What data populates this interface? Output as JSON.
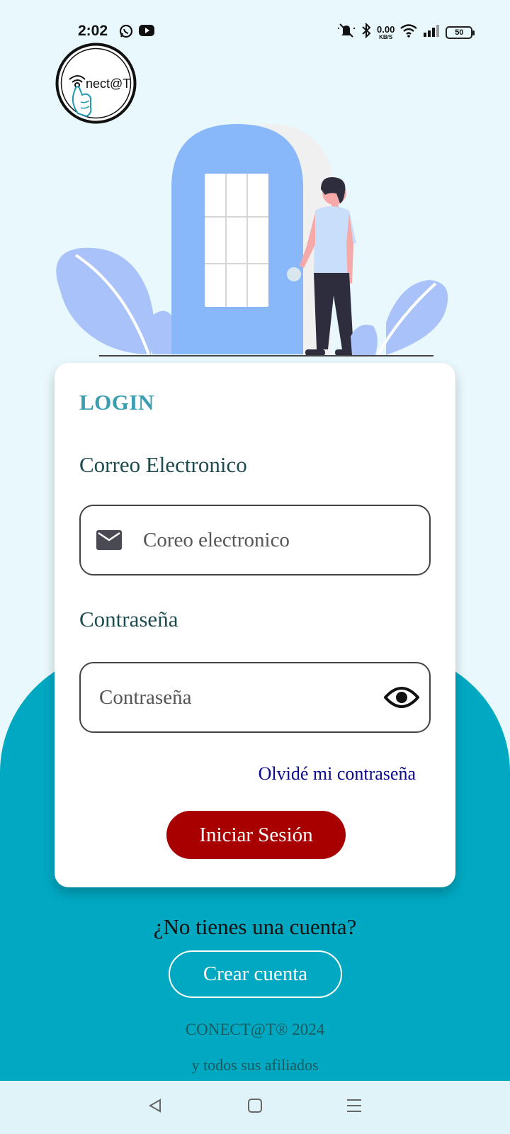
{
  "status_bar": {
    "time": "2:02",
    "net_speed_value": "0.00",
    "net_speed_unit": "KB/S",
    "battery": "50",
    "icons": [
      "whatsapp-icon",
      "youtube-icon",
      "mute-icon",
      "bluetooth-icon",
      "wifi-icon",
      "signal-icon",
      "battery-icon"
    ]
  },
  "logo": {
    "text": "nect@T"
  },
  "login": {
    "title": "LOGIN",
    "email_label": "Correo Electronico",
    "email_placeholder": "Coreo electronico",
    "password_label": "Contraseña",
    "password_placeholder": "Contraseña",
    "forgot_password": "Olvidé mi contraseña",
    "submit": "Iniciar Sesión"
  },
  "signup": {
    "prompt": "¿No tienes una cuenta?",
    "button": "Crear cuenta"
  },
  "footer": {
    "copyright": "CONECT@T® 2024",
    "affiliates": "y todos sus afiliados"
  },
  "colors": {
    "background": "#e9f8fc",
    "teal": "#00a8c2",
    "login_button": "#a80000",
    "title": "#3a9eb0",
    "link": "#0a0a90"
  }
}
